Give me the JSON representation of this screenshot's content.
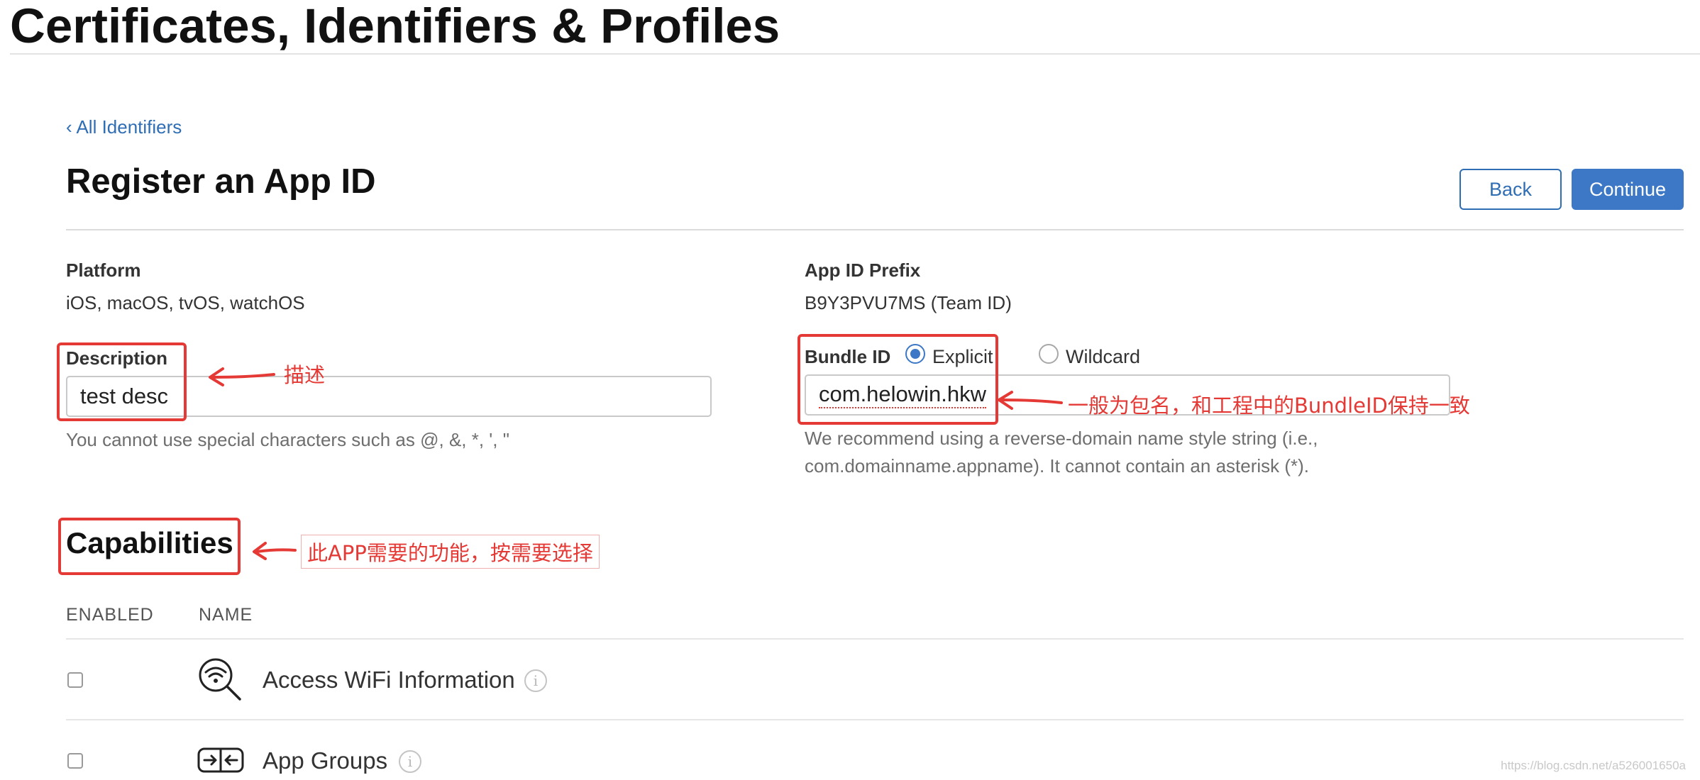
{
  "page": {
    "title": "Certificates, Identifiers & Profiles"
  },
  "nav": {
    "back_link": "‹ All Identifiers"
  },
  "header": {
    "title": "Register an App ID",
    "back_button": "Back",
    "continue_button": "Continue"
  },
  "platform": {
    "label": "Platform",
    "value": "iOS, macOS, tvOS, watchOS"
  },
  "prefix": {
    "label": "App ID Prefix",
    "value": "B9Y3PVU7MS (Team ID)"
  },
  "description": {
    "label": "Description",
    "value": "test desc",
    "hint": "You cannot use special characters such as @, &, *, ', \""
  },
  "bundle": {
    "label": "Bundle ID",
    "option_explicit": "Explicit",
    "option_wildcard": "Wildcard",
    "value": "com.helowin.hkw",
    "hint_line1": "We recommend using a reverse-domain name style string (i.e.,",
    "hint_line2": "com.domainname.appname). It cannot contain an asterisk (*)."
  },
  "capabilities": {
    "title": "Capabilities",
    "col_enabled": "ENABLED",
    "col_name": "NAME",
    "items": [
      {
        "name": "Access WiFi Information",
        "icon": "wifi-search-icon",
        "enabled": false
      },
      {
        "name": "App Groups",
        "icon": "app-groups-icon",
        "enabled": false
      }
    ]
  },
  "annotations": {
    "description": "描述",
    "bundle": "一般为包名，和工程中的BundleID保持一致",
    "capabilities": "此APP需要的功能，按需要选择"
  },
  "watermark": "https://blog.csdn.net/a526001650a",
  "colors": {
    "accent": "#3c78c6",
    "link": "#2f6eb5",
    "annotation": "#e53935"
  }
}
